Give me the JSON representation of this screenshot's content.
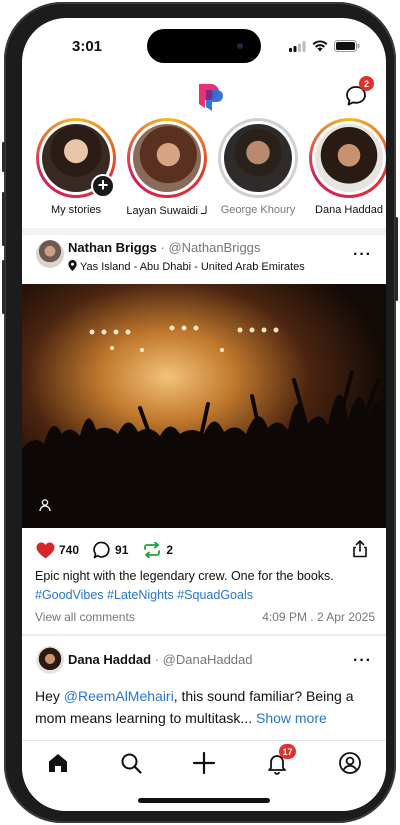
{
  "status_bar": {
    "time": "3:01"
  },
  "header": {
    "chat_badge": "2"
  },
  "stories": [
    {
      "name": "My stories",
      "state": "active",
      "own": true
    },
    {
      "name": "Layan Suwaidi لـ",
      "state": "active"
    },
    {
      "name": "George Khoury",
      "state": "seen"
    },
    {
      "name": "Dana Haddad",
      "state": "active"
    }
  ],
  "post": {
    "author": "Nathan Briggs",
    "handle": "@NathanBriggs",
    "location": "Yas Island - Abu Dhabi - United Arab Emirates",
    "likes": "740",
    "comments": "91",
    "reposts": "2",
    "caption": "Epic night with the legendary crew. One for the books.",
    "hashtags": "#GoodVibes #LateNights #SquadGoals",
    "view_comments": "View all comments",
    "timestamp": "4:09 PM . 2 Apr 2025"
  },
  "post2": {
    "author": "Dana Haddad",
    "handle": "@DanaHaddad",
    "text_before": "Hey ",
    "mention": "@ReemAlMehairi",
    "text_after": ", this sound familiar? Being a mom means learning to multitask... ",
    "show_more": "Show more"
  },
  "tabbar": {
    "notifications_badge": "17"
  },
  "colors": {
    "accent_blue": "#2677d0",
    "like_red": "#d7262b",
    "repost_green": "#1aa33a",
    "badge_red": "#e0322b"
  }
}
